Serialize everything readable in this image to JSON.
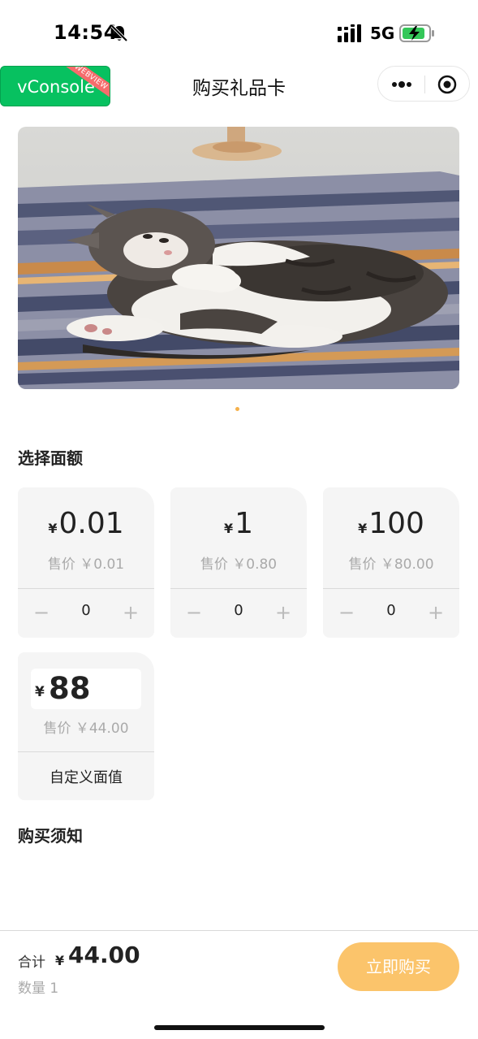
{
  "status_bar": {
    "time": "14:54",
    "network": "5G",
    "icons": [
      "bell-slash-icon",
      "signal-icon",
      "battery-charging-icon"
    ]
  },
  "nav": {
    "vconsole_label": "vConsole",
    "vconsole_ribbon": "WEBVIEW",
    "title": "购买礼品卡",
    "icons": [
      "more-icon",
      "close-target-icon"
    ]
  },
  "banner": {
    "image": "sleeping-kitten-photo",
    "dots_count": 1
  },
  "denomination_section": {
    "title": "选择面额",
    "currency": "¥",
    "cards": [
      {
        "face_value": "0.01",
        "price_label": "售价 ￥0.01",
        "quantity": "0",
        "minus": "−",
        "plus": "+"
      },
      {
        "face_value": "1",
        "price_label": "售价 ￥0.80",
        "quantity": "0",
        "minus": "−",
        "plus": "+"
      },
      {
        "face_value": "100",
        "price_label": "售价 ￥80.00",
        "quantity": "0",
        "minus": "−",
        "plus": "+"
      }
    ],
    "custom_card": {
      "value": "88",
      "price_label": "售价 ￥44.00",
      "label": "自定义面值"
    }
  },
  "notice_section": {
    "title": "购买须知"
  },
  "bottom_bar": {
    "total_label": "合计",
    "currency": "¥",
    "total_amount": "44.00",
    "quantity_label": "数量 1",
    "buy_label": "立即购买"
  },
  "colors": {
    "accent": "#fbc46b",
    "vconsole_green": "#07c160",
    "card_bg": "#f5f5f5",
    "muted_text": "#aaaaaa"
  }
}
